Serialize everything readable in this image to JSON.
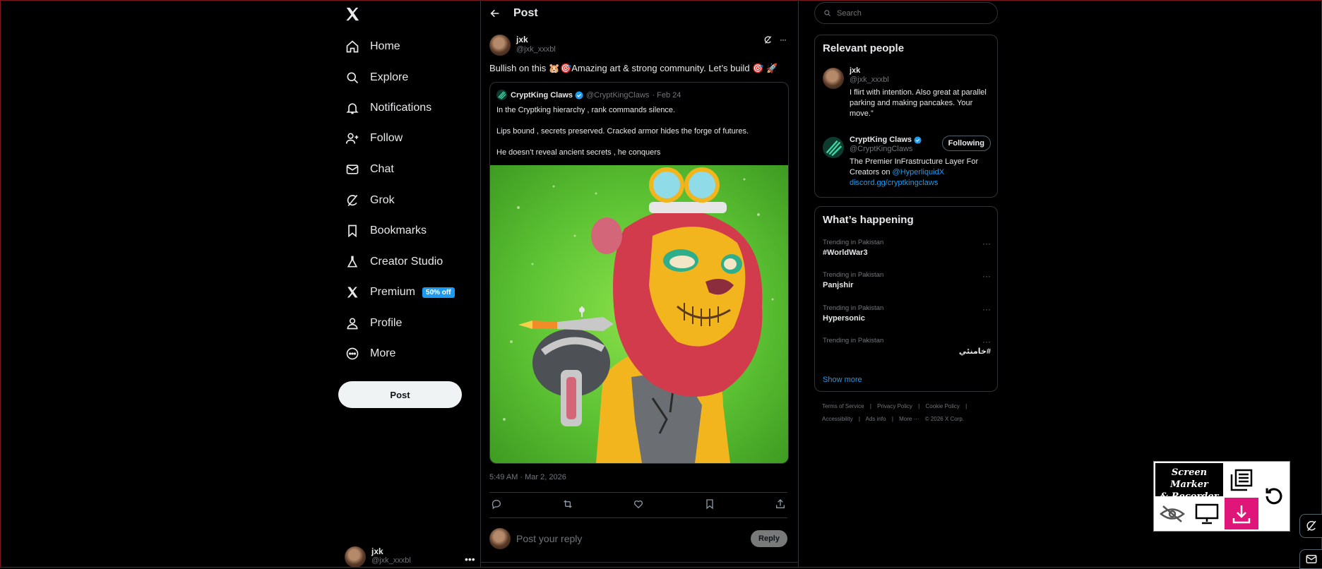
{
  "nav": {
    "items": [
      {
        "label": "Home",
        "icon": "home-icon"
      },
      {
        "label": "Explore",
        "icon": "search-icon"
      },
      {
        "label": "Notifications",
        "icon": "bell-icon"
      },
      {
        "label": "Follow",
        "icon": "follow-icon"
      },
      {
        "label": "Chat",
        "icon": "mail-icon"
      },
      {
        "label": "Grok",
        "icon": "grok-icon"
      },
      {
        "label": "Bookmarks",
        "icon": "bookmark-icon"
      },
      {
        "label": "Creator Studio",
        "icon": "flask-icon"
      },
      {
        "label": "Premium",
        "icon": "x-icon",
        "badge": "50% off"
      },
      {
        "label": "Profile",
        "icon": "person-icon"
      },
      {
        "label": "More",
        "icon": "more-circle-icon"
      }
    ],
    "post_button": "Post",
    "account": {
      "name": "jxk",
      "handle": "@jxk_xxxbl"
    }
  },
  "header": {
    "title": "Post"
  },
  "post": {
    "author_name": "jxk",
    "author_handle": "@jxk_xxxbl",
    "text": "Bullish on this 🐹🎯Amazing art & strong community. Let’s build 🎯 🚀",
    "timestamp": "5:49 AM · Mar 2, 2026",
    "quote": {
      "name": "CryptKing Claws",
      "handle": "@CryptKingClaws",
      "date": "· Feb 24",
      "lines": [
        "In the Cryptking hierarchy , rank commands silence.",
        "Lips bound , secrets preserved. Cracked armor hides the forge of futures.",
        "He doesn’t reveal ancient secrets , he conquers"
      ]
    },
    "reply_placeholder": "Post your reply",
    "reply_button": "Reply"
  },
  "search": {
    "placeholder": "Search"
  },
  "relevant": {
    "title": "Relevant people",
    "people": [
      {
        "name": "jxk",
        "handle": "@jxk_xxxbl",
        "bio": "I flirt with intention. Also great at parallel parking and making pancakes. Your move.”"
      },
      {
        "name": "CryptKing Claws",
        "handle": "@CryptKingClaws",
        "follow_label": "Following",
        "bio_prefix": "The Premier InFrastructure Layer For Creators on ",
        "bio_mention": "@HyperliquidX",
        "bio_link": "discord.gg/cryptkingclaws"
      }
    ]
  },
  "trending": {
    "title": "What’s happening",
    "items": [
      {
        "context": "Trending in Pakistan",
        "topic": "#WorldWar3"
      },
      {
        "context": "Trending in Pakistan",
        "topic": "Panjshir"
      },
      {
        "context": "Trending in Pakistan",
        "topic": "Hypersonic"
      },
      {
        "context": "Trending in Pakistan",
        "topic": "#خامنئي"
      }
    ],
    "show_more": "Show more"
  },
  "footer": {
    "row1": [
      "Terms of Service",
      "|",
      "Privacy Policy",
      "|",
      "Cookie Policy",
      "|"
    ],
    "row2": [
      "Accessibility",
      "|",
      "Ads info",
      "|",
      "More ···",
      "© 2026 X Corp."
    ]
  },
  "widget": {
    "title_line1": "Screen Marker",
    "title_line2": "& Recorder"
  },
  "colors": {
    "background": "#000000",
    "accent": "#1d9bf0",
    "border": "#2f3336",
    "widget_pink": "#e0157a"
  }
}
